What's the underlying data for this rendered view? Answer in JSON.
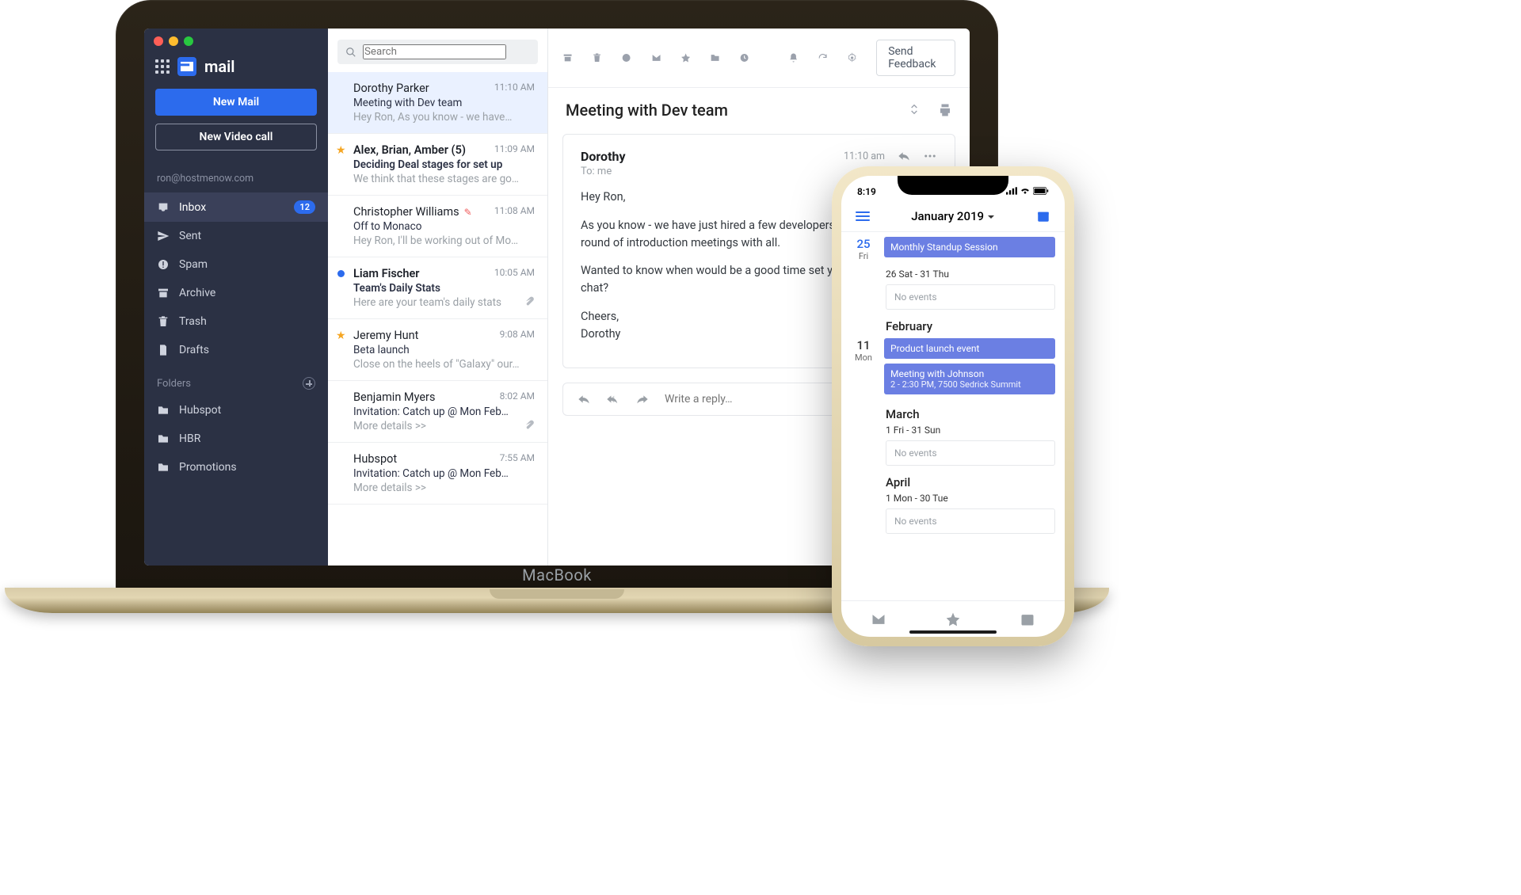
{
  "sidebar": {
    "brand": "mail",
    "new_mail": "New Mail",
    "video_call": "New Video call",
    "account": "ron@hostmenow.com",
    "inbox": "Inbox",
    "inbox_badge": "12",
    "sent": "Sent",
    "spam": "Spam",
    "archive": "Archive",
    "trash": "Trash",
    "drafts": "Drafts",
    "folders_label": "Folders",
    "folders": [
      {
        "label": "Hubspot"
      },
      {
        "label": "HBR"
      },
      {
        "label": "Promotions"
      }
    ]
  },
  "search": {
    "placeholder": "Search"
  },
  "toolbar": {
    "feedback": "Send Feedback"
  },
  "messages": {
    "m0": {
      "from": "Dorothy Parker",
      "time": "11:10 AM",
      "subject": "Meeting with Dev team",
      "preview": "Hey Ron, As you know - we have…"
    },
    "m1": {
      "from": "Alex, Brian, Amber (5)",
      "time": "11:09 AM",
      "subject": "Deciding Deal stages for set up",
      "preview": "We think that these stages are go…"
    },
    "m2": {
      "from": "Christopher Williams",
      "time": "11:08 AM",
      "subject": "Off to Monaco",
      "preview": "Hey Ron, I'll be working out of Mo…"
    },
    "m3": {
      "from": "Liam Fischer",
      "time": "10:05 AM",
      "subject": "Team's Daily Stats",
      "preview": "Here are your team's daily stats"
    },
    "m4": {
      "from": "Jeremy Hunt",
      "time": "9:08 AM",
      "subject": "Beta launch",
      "preview": "Close on the heels of \"Galaxy\" our…"
    },
    "m5": {
      "from": "Benjamin Myers",
      "time": "8:02 AM",
      "subject": "Invitation: Catch up @ Mon Feb…",
      "preview": "More details >>"
    },
    "m6": {
      "from": "Hubspot",
      "time": "7:55 AM",
      "subject": "Invitation: Catch up @ Mon Feb…",
      "preview": "More details >>"
    }
  },
  "reader": {
    "subject": "Meeting with Dev team",
    "sender": "Dorothy",
    "to": "To: me",
    "time": "11:10 am",
    "body": {
      "p0": "Hey Ron,",
      "p1": "As you know - we have just hired a few developers and were doing a round of introduction meetings with all.",
      "p2": "Wanted to know when would be a good time set you up for a quick chat?",
      "p3": "Cheers,",
      "p4": "Dorothy"
    },
    "reply_placeholder": "Write a reply…"
  },
  "phone": {
    "status_time": "8:19",
    "month": "January 2019",
    "d25": {
      "num": "25",
      "dow": "Fri",
      "event": "Monthly Standup Session"
    },
    "jan_range": "26 Sat - 31 Thu",
    "jan_noevents": "No events",
    "feb": "February",
    "d11": {
      "num": "11",
      "dow": "Mon",
      "e1": "Product launch event",
      "e2": "Meeting with Johnson",
      "e2_sub": "2 - 2:30 PM, 7500 Sedrick Summit"
    },
    "mar": "March",
    "mar_range": "1 Fri - 31 Sun",
    "mar_noevents": "No events",
    "apr": "April",
    "apr_range": "1 Mon - 30 Tue",
    "apr_noevents": "No events"
  }
}
